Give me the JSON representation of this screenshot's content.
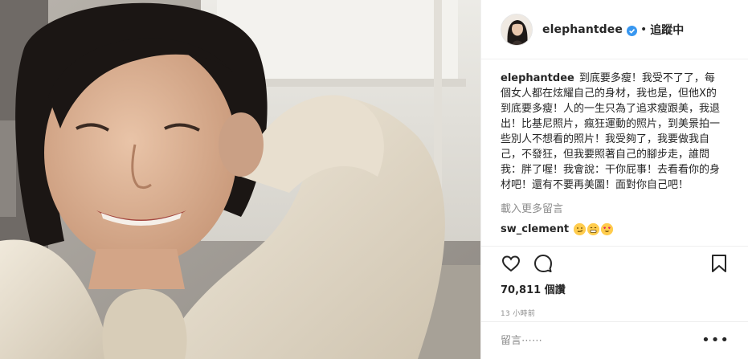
{
  "post": {
    "photo_alt": "selfie"
  },
  "header": {
    "username": "elephantdee",
    "separator": "•",
    "follow_status": "追蹤中",
    "verified_icon": "verified-badge-icon",
    "accent_color": "#3897f0"
  },
  "caption": {
    "username": "elephantdee",
    "text": "到底要多瘦！我受不了了，每個女人都在炫耀自己的身材，我也是，但他X的到底要多瘦！人的一生只為了追求瘦跟美，我退出！比基尼照片，瘋狂運動的照片，到美景拍一些別人不想看的照片！我受夠了，我要做我自己，不發狂，但我要照著自己的腳步走，誰問我：胖了喔！我會說：干你屁事！去看看你的身材吧！還有不要再美圖！面對你自己吧！"
  },
  "comments": {
    "load_more": "載入更多留言",
    "items": [
      {
        "username": "sw_clement",
        "emojis": [
          "smirk-emoji",
          "grin-emoji",
          "heart-eyes-emoji"
        ]
      }
    ]
  },
  "actions": {
    "icons": [
      "heart-icon",
      "comment-icon",
      "bookmark-icon"
    ],
    "views": "70,811 個讚",
    "time": "13 小時前"
  },
  "composer": {
    "placeholder": "留言⋯⋯",
    "more_icon": "more-options-icon"
  }
}
